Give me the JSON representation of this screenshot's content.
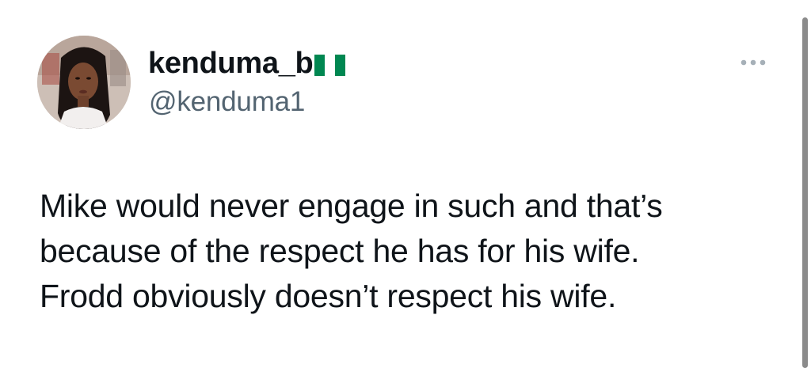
{
  "tweet": {
    "author": {
      "display_name": "kenduma_b",
      "flag_icon": "nigeria-flag-icon",
      "handle": "@kenduma1"
    },
    "more_icon": "more-horizontal-icon",
    "text": "Mike would never engage in such and that’s\nbecause of the respect he has for his wife.\nFrodd obviously doesn’t respect his wife."
  },
  "colors": {
    "text_primary": "#0f1419",
    "text_secondary": "#536471",
    "flag_green": "#008751",
    "flag_white": "#ffffff",
    "scrollbar": "#8b8b8b"
  }
}
